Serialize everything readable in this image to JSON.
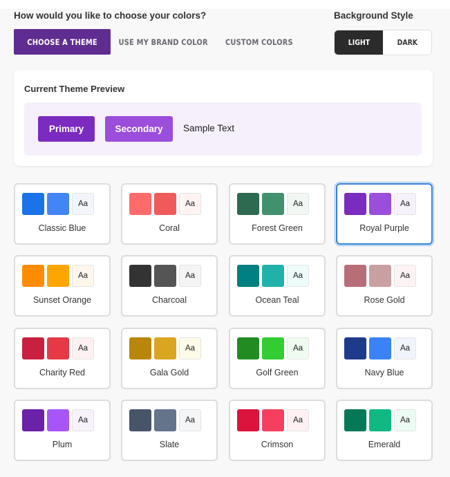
{
  "header": {
    "question": "How would you like to choose your colors?",
    "background_title": "Background Style"
  },
  "tabs": [
    {
      "label": "CHOOSE A THEME",
      "active": true
    },
    {
      "label": "USE MY BRAND COLOR",
      "active": false
    },
    {
      "label": "CUSTOM COLORS",
      "active": false
    }
  ],
  "background_style": {
    "options": [
      {
        "label": "LIGHT",
        "active": true
      },
      {
        "label": "DARK",
        "active": false
      }
    ]
  },
  "preview": {
    "title": "Current Theme Preview",
    "primary_label": "Primary",
    "secondary_label": "Secondary",
    "sample_text": "Sample Text",
    "primary_color": "#7b2bc0",
    "secondary_color": "#9b4ddb",
    "background_color": "#f5f0fb"
  },
  "swatch_text": "Aa",
  "themes": [
    {
      "name": "Classic Blue",
      "primary": "#1a73e8",
      "secondary": "#4285f4",
      "text_bg": "#f2f6fc",
      "selected": false
    },
    {
      "name": "Coral",
      "primary": "#ff6b6b",
      "secondary": "#f05a5a",
      "text_bg": "#fff3f3",
      "selected": false
    },
    {
      "name": "Forest Green",
      "primary": "#2d6a4f",
      "secondary": "#40916c",
      "text_bg": "#f1f7f3",
      "selected": false
    },
    {
      "name": "Royal Purple",
      "primary": "#7b2bc0",
      "secondary": "#9b4ddb",
      "text_bg": "#f6f1fb",
      "selected": true
    },
    {
      "name": "Sunset Orange",
      "primary": "#ff8c00",
      "secondary": "#ffa500",
      "text_bg": "#fff7ec",
      "selected": false
    },
    {
      "name": "Charcoal",
      "primary": "#333333",
      "secondary": "#555555",
      "text_bg": "#f4f4f4",
      "selected": false
    },
    {
      "name": "Ocean Teal",
      "primary": "#008080",
      "secondary": "#20b2aa",
      "text_bg": "#eefbfb",
      "selected": false
    },
    {
      "name": "Rose Gold",
      "primary": "#b76e79",
      "secondary": "#c9a0a0",
      "text_bg": "#fdf3f4",
      "selected": false
    },
    {
      "name": "Charity Red",
      "primary": "#c8203e",
      "secondary": "#e63946",
      "text_bg": "#fff1f2",
      "selected": false
    },
    {
      "name": "Gala Gold",
      "primary": "#b8860b",
      "secondary": "#daa520",
      "text_bg": "#fdfbe8",
      "selected": false
    },
    {
      "name": "Golf Green",
      "primary": "#228b22",
      "secondary": "#32cd32",
      "text_bg": "#effbef",
      "selected": false
    },
    {
      "name": "Navy Blue",
      "primary": "#1e3a8a",
      "secondary": "#3b82f6",
      "text_bg": "#f0f4fb",
      "selected": false
    },
    {
      "name": "Plum",
      "primary": "#6b21a8",
      "secondary": "#a855f7",
      "text_bg": "#f8f2fd",
      "selected": false
    },
    {
      "name": "Slate",
      "primary": "#475569",
      "secondary": "#64748b",
      "text_bg": "#f4f5f7",
      "selected": false
    },
    {
      "name": "Crimson",
      "primary": "#dc143c",
      "secondary": "#f43f5e",
      "text_bg": "#fff1f3",
      "selected": false
    },
    {
      "name": "Emerald",
      "primary": "#047857",
      "secondary": "#10b981",
      "text_bg": "#ecfbf4",
      "selected": false
    }
  ]
}
